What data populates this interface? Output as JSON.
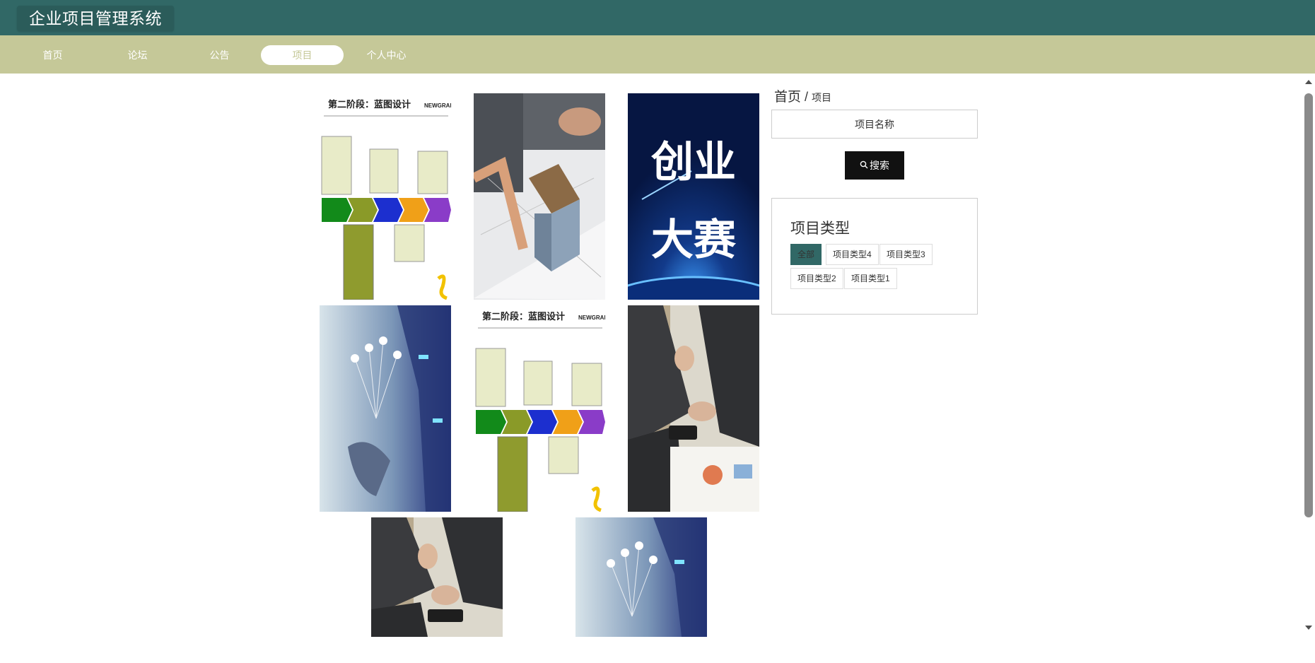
{
  "app": {
    "title": "企业项目管理系统"
  },
  "nav": {
    "items": [
      {
        "label": "首页",
        "active": false
      },
      {
        "label": "论坛",
        "active": false
      },
      {
        "label": "公告",
        "active": false
      },
      {
        "label": "项目",
        "active": true
      },
      {
        "label": "个人中心",
        "active": false
      }
    ]
  },
  "breadcrumb": {
    "home": "首页",
    "separator": "/",
    "current": "项目"
  },
  "search": {
    "placeholder": "项目名称",
    "button_label": "搜索",
    "button_icon": "search-icon"
  },
  "types": {
    "title": "项目类型",
    "tags": [
      {
        "label": "全部",
        "active": true
      },
      {
        "label": "项目类型4",
        "active": false
      },
      {
        "label": "项目类型3",
        "active": false
      },
      {
        "label": "项目类型2",
        "active": false
      },
      {
        "label": "项目类型1",
        "active": false
      }
    ]
  },
  "projects": [
    {
      "image": "blueprint-stage-diagram",
      "image_text": {
        "title": "第二阶段：蓝图设计",
        "brand": "NEWGRAND"
      }
    },
    {
      "image": "house-model-architect-photo"
    },
    {
      "image": "startup-contest-poster",
      "image_text": {
        "line1": "创业",
        "line2": "大赛"
      }
    },
    {
      "image": "digital-tech-hand-photo"
    },
    {
      "image": "blueprint-stage-diagram",
      "image_text": {
        "title": "第二阶段：蓝图设计",
        "brand": "NEWGRAND"
      }
    },
    {
      "image": "business-meeting-phone-photo"
    },
    {
      "image": "business-meeting-phone-photo"
    },
    {
      "image": "digital-tech-hand-photo"
    }
  ],
  "colors": {
    "header_bg": "#316866",
    "nav_bg": "#c5c898",
    "active_tag_bg": "#316866",
    "search_button_bg": "#111111"
  }
}
